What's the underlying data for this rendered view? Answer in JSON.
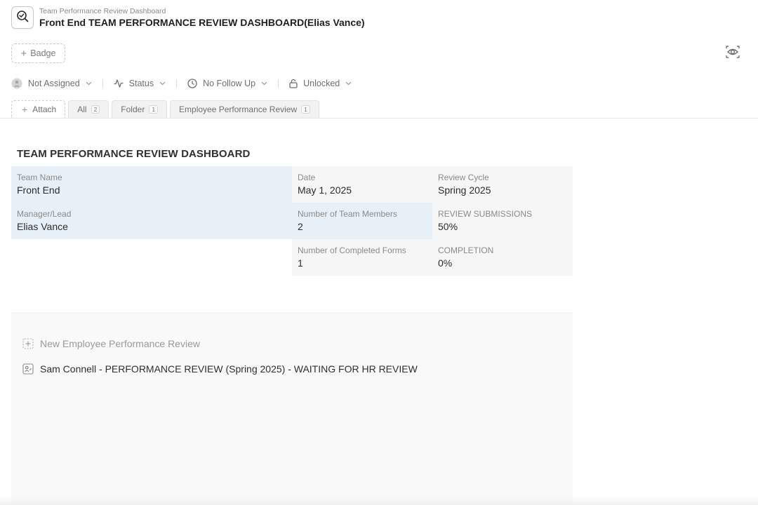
{
  "header": {
    "breadcrumb": "Team Performance Review Dashboard",
    "title": "Front End TEAM PERFORMANCE REVIEW DASHBOARD(Elias Vance)"
  },
  "toolbar": {
    "badge_label": "Badge"
  },
  "filters": {
    "assignee": "Not Assigned",
    "status": "Status",
    "follow_up": "No Follow Up",
    "lock": "Unlocked"
  },
  "tabs": {
    "attach": "Attach",
    "items": [
      {
        "label": "All",
        "count": "2"
      },
      {
        "label": "Folder",
        "count": "1"
      },
      {
        "label": "Employee Performance Review",
        "count": "1"
      }
    ]
  },
  "dashboard": {
    "title": "TEAM PERFORMANCE REVIEW DASHBOARD",
    "fields": {
      "team_name": {
        "label": "Team Name",
        "value": "Front End"
      },
      "manager": {
        "label": "Manager/Lead",
        "value": "Elias Vance"
      },
      "date": {
        "label": "Date",
        "value": "May 1, 2025"
      },
      "members": {
        "label": "Number of Team Members",
        "value": "2"
      },
      "completed": {
        "label": "Number of Completed Forms",
        "value": "1"
      },
      "cycle": {
        "label": "Review Cycle",
        "value": "Spring 2025"
      },
      "submissions": {
        "label": "REVIEW SUBMISSIONS",
        "value": "50%"
      },
      "completion": {
        "label": "COMPLETION",
        "value": "0%"
      }
    }
  },
  "list": {
    "new_item": "New Employee Performance Review",
    "items": [
      "Sam Connell - PERFORMANCE REVIEW (Spring 2025) - WAITING FOR HR REVIEW"
    ]
  },
  "icons": {
    "app": "magnifier-check-icon",
    "preview": "eye-icon",
    "assignee": "user-circle-icon",
    "status": "activity-icon",
    "follow_up": "clock-icon",
    "lock": "unlock-icon",
    "new_item": "plus-square-icon",
    "item": "person-card-icon"
  }
}
